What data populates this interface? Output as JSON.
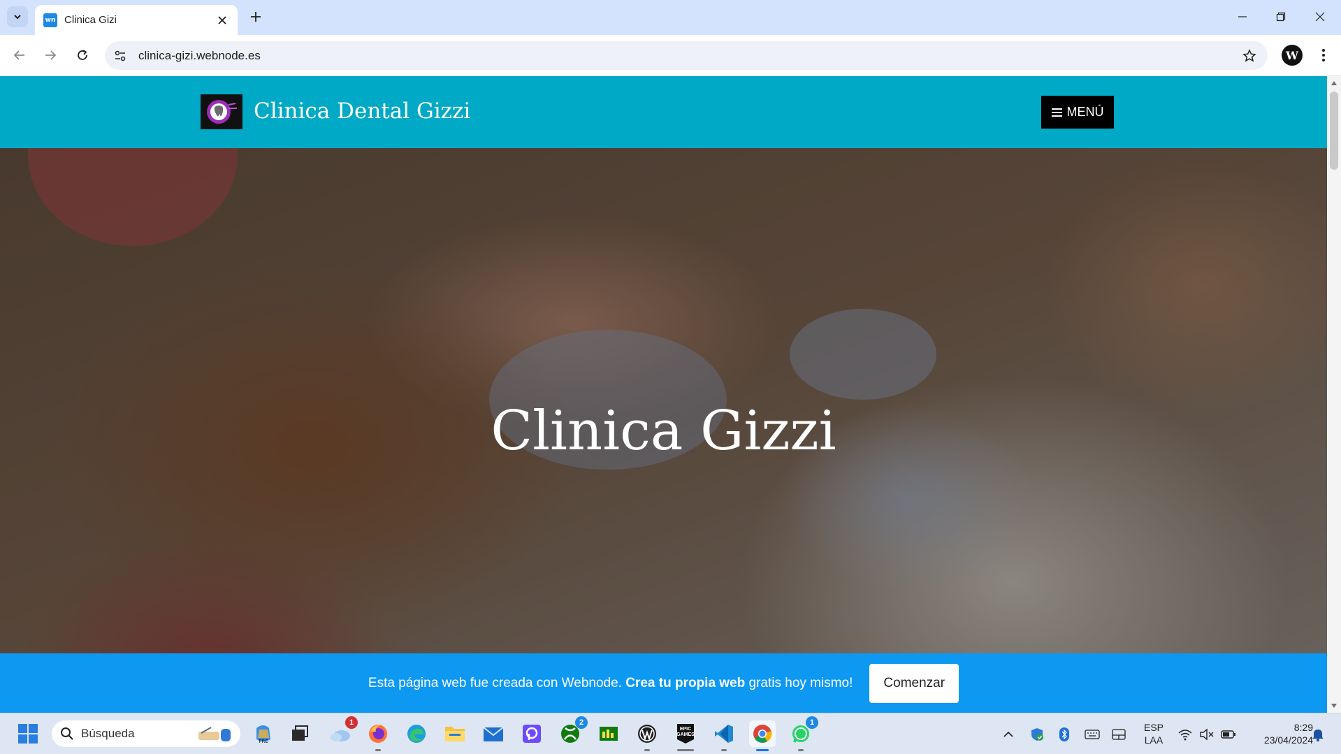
{
  "browser": {
    "tab_title": "Clinica Gizi",
    "favicon_text": "wn",
    "url": "clinica-gizi.webnode.es",
    "profile_initial": "W"
  },
  "site": {
    "name": "Clinica Dental Gizzi",
    "menu_label": "MENÚ",
    "hero_title": "Clinica Gizzi",
    "banner_text_1": "Esta página web fue creada con Webnode.",
    "banner_text_bold": "Crea tu propia web",
    "banner_text_2": "gratis hoy mismo!",
    "banner_cta": "Comenzar",
    "header_color": "#00a9c5",
    "banner_color": "#0d99f2"
  },
  "taskbar": {
    "search_placeholder": "Búsqueda",
    "apps": [
      {
        "name": "copilot-icon",
        "badge": ""
      },
      {
        "name": "task-view-icon",
        "badge": ""
      },
      {
        "name": "weather-icon",
        "badge": "1"
      },
      {
        "name": "firefox-icon",
        "badge": ""
      },
      {
        "name": "edge-icon",
        "badge": ""
      },
      {
        "name": "file-explorer-icon",
        "badge": ""
      },
      {
        "name": "mail-icon",
        "badge": ""
      },
      {
        "name": "proton-icon",
        "badge": ""
      },
      {
        "name": "xbox-icon",
        "badge": "2"
      },
      {
        "name": "game-pass-icon",
        "badge": ""
      },
      {
        "name": "wordpress-icon",
        "badge": ""
      },
      {
        "name": "epic-games-icon",
        "badge": ""
      },
      {
        "name": "vscode-icon",
        "badge": ""
      },
      {
        "name": "chrome-icon",
        "badge": ""
      },
      {
        "name": "whatsapp-icon",
        "badge": "1"
      }
    ],
    "epic_label": "EPIC GAMES",
    "language_top": "ESP",
    "language_bottom": "LAA",
    "time": "8:29",
    "date": "23/04/2024"
  }
}
